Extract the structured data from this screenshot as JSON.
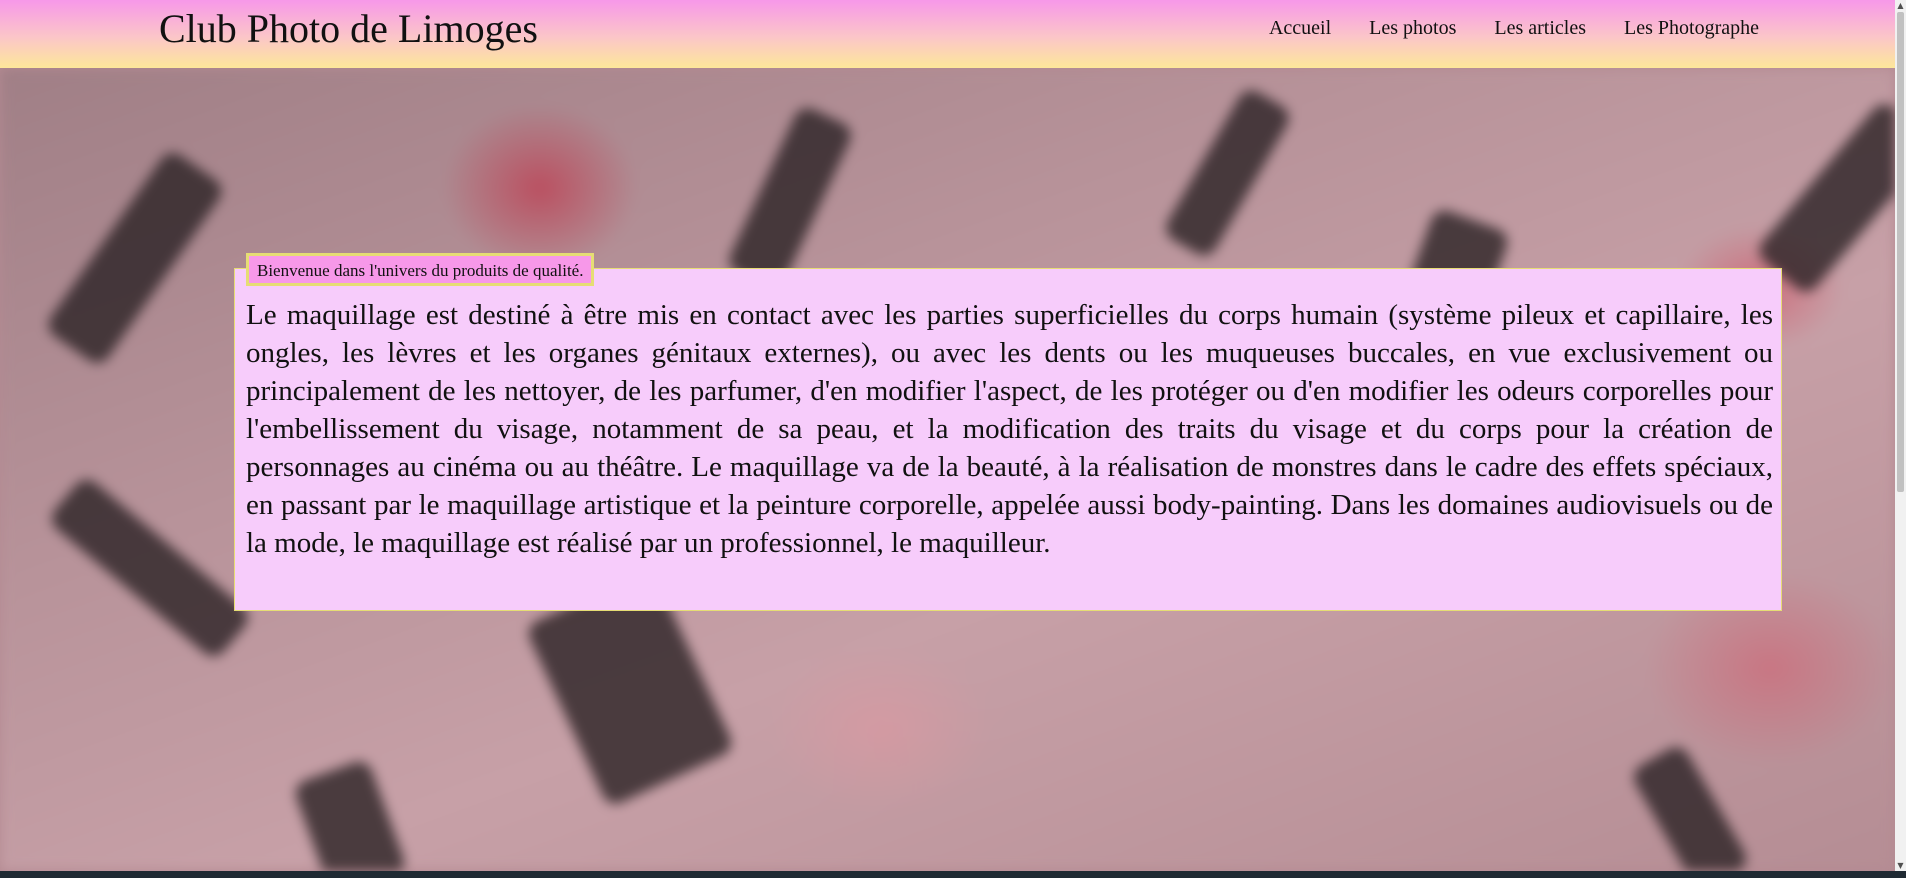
{
  "header": {
    "site_title": "Club Photo de Limoges",
    "nav": [
      {
        "label": "Accueil"
      },
      {
        "label": "Les photos"
      },
      {
        "label": "Les articles"
      },
      {
        "label": "Les Photographe"
      }
    ]
  },
  "main": {
    "legend": "Bienvenue dans l'univers du produits de qualité.",
    "paragraph": "Le maquillage est destiné à être mis en contact avec les parties superficielles du corps humain (système pileux et capillaire, les ongles, les lèvres et les organes génitaux externes), ou avec les dents ou les muqueuses buccales, en vue exclusivement ou principalement de les nettoyer, de les parfumer, d'en modifier l'aspect, de les protéger ou d'en modifier les odeurs corporelles pour l'embellissement du visage, notamment de sa peau, et la modification des traits du visage et du corps pour la création de personnages au cinéma ou au théâtre. Le maquillage va de la beauté, à la réalisation de monstres dans le cadre des effets spéciaux, en passant par le maquillage artistique et la peinture corporelle, appelée aussi body-painting. Dans les domaines audiovisuels ou de la mode, le maquillage est réalisé par un professionnel, le maquilleur."
  },
  "colors": {
    "header_top": "#f798e9",
    "header_bottom": "#fde79a",
    "panel_bg": "#f7ccfb",
    "panel_border": "#e6dd74",
    "legend_bg": "#f798e9"
  },
  "icons": {
    "scroll_up": "▲",
    "scroll_down": "▼"
  }
}
